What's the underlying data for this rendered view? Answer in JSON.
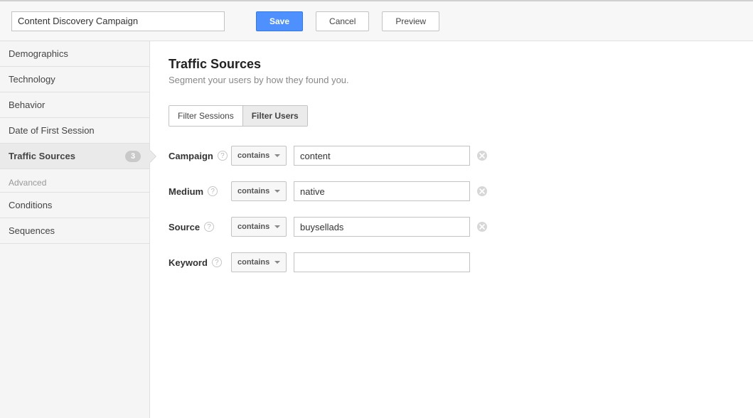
{
  "header": {
    "segment_name": "Content Discovery Campaign",
    "save_label": "Save",
    "cancel_label": "Cancel",
    "preview_label": "Preview"
  },
  "sidebar": {
    "items": [
      {
        "label": "Demographics"
      },
      {
        "label": "Technology"
      },
      {
        "label": "Behavior"
      },
      {
        "label": "Date of First Session"
      },
      {
        "label": "Traffic Sources",
        "badge": "3",
        "active": true
      }
    ],
    "advanced_label": "Advanced",
    "advanced_items": [
      {
        "label": "Conditions"
      },
      {
        "label": "Sequences"
      }
    ]
  },
  "page": {
    "title": "Traffic Sources",
    "subtitle": "Segment your users by how they found you.",
    "tabs": {
      "sessions": "Filter Sessions",
      "users": "Filter Users"
    },
    "filters": [
      {
        "label": "Campaign",
        "operator": "contains",
        "value": "content",
        "clearable": true
      },
      {
        "label": "Medium",
        "operator": "contains",
        "value": "native",
        "clearable": true
      },
      {
        "label": "Source",
        "operator": "contains",
        "value": "buysellads",
        "clearable": true
      },
      {
        "label": "Keyword",
        "operator": "contains",
        "value": "",
        "clearable": false
      }
    ]
  }
}
